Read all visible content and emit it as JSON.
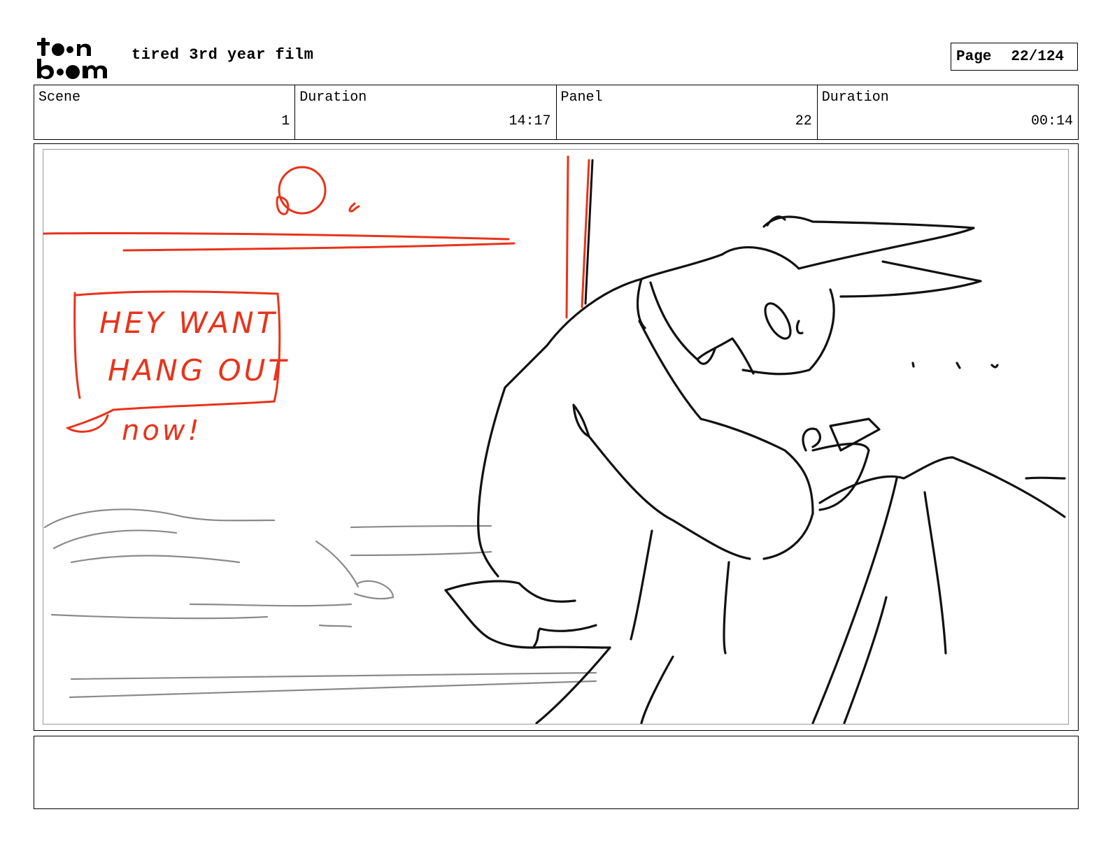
{
  "header": {
    "logo_text": "toon boom",
    "project_title": "tired 3rd year film",
    "page_label": "Page",
    "page_number": "22/124"
  },
  "info": {
    "scene_label": "Scene",
    "scene_value": "1",
    "scene_duration_label": "Duration",
    "scene_duration_value": "14:17",
    "panel_label": "Panel",
    "panel_value": "22",
    "panel_duration_label": "Duration",
    "panel_duration_value": "00:14"
  },
  "sketch": {
    "speech_bubble_line1": "HEY WANT",
    "speech_bubble_line2": "HANG OUT",
    "exclamation": "now!",
    "colors": {
      "red": "#e8331a",
      "ink": "#111111",
      "pencil": "#8a8a8a"
    }
  },
  "notes": {
    "text": ""
  }
}
